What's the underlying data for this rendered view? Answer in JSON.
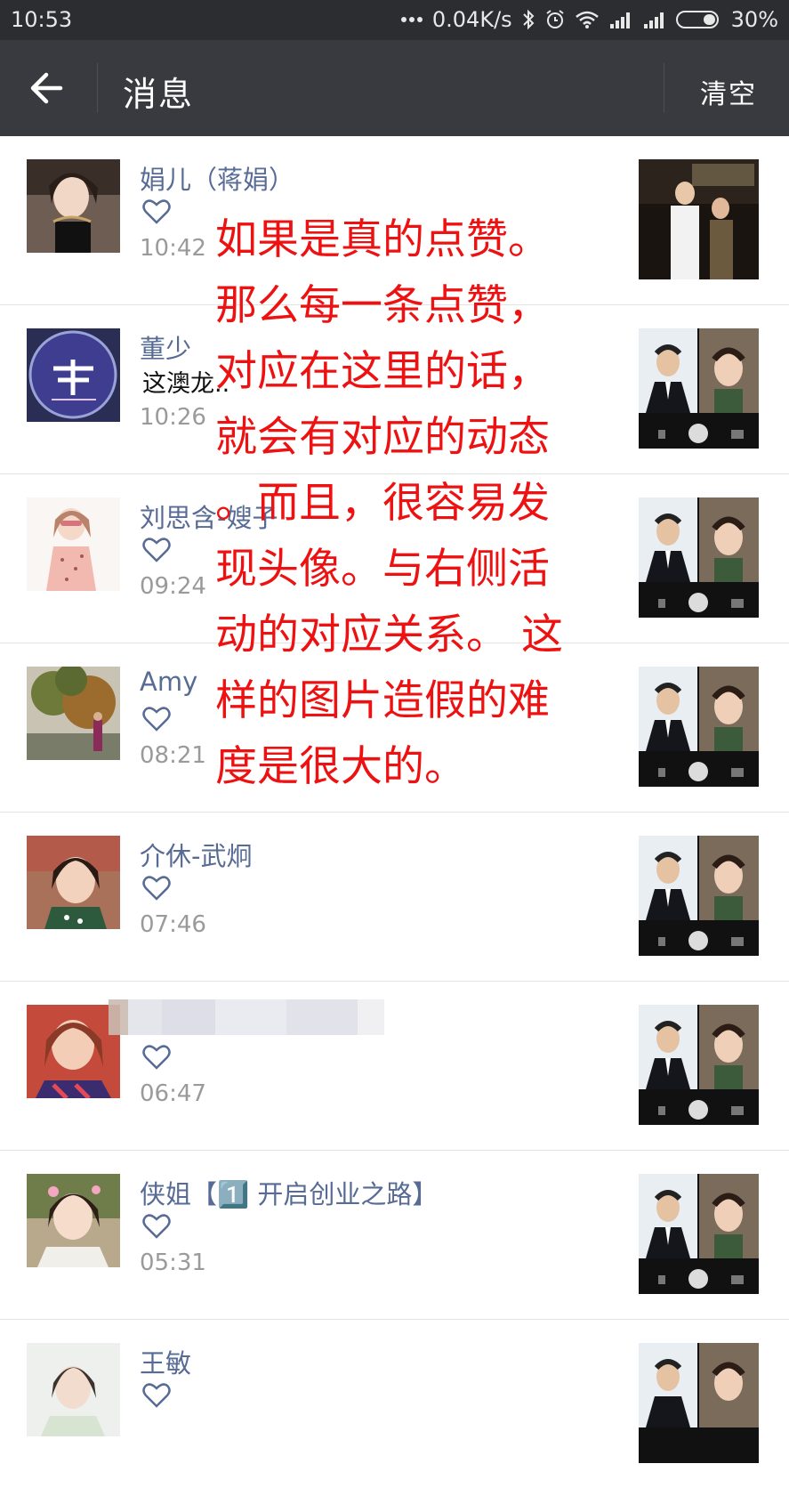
{
  "status_bar": {
    "time": "10:53",
    "network_speed": "0.04K/s",
    "battery": "30%",
    "icons": [
      "more-dots-icon",
      "bluetooth-icon",
      "alarm-icon",
      "wifi-icon",
      "signal-icon",
      "signal-icon",
      "battery-icon"
    ]
  },
  "header": {
    "back_icon": "arrow-left-icon",
    "title": "消息",
    "clear_label": "清空",
    "background": "#393a3f"
  },
  "messages": [
    {
      "name": "娟儿（蒋娟）",
      "type": "like",
      "time": "10:42"
    },
    {
      "name": "董少",
      "type": "comment",
      "text": "这澳龙..",
      "time": "10:26"
    },
    {
      "name": "刘思含-嫂子",
      "type": "like",
      "time": "09:24"
    },
    {
      "name": "Amy",
      "type": "like",
      "time": "08:21"
    },
    {
      "name": "介休-武炯",
      "type": "like",
      "time": "07:46"
    },
    {
      "name": "",
      "type": "like",
      "time": "06:47"
    },
    {
      "name": "侠姐【1️⃣ 开启创业之路】",
      "type": "like",
      "time": "05:31"
    },
    {
      "name": "王敏",
      "type": "like",
      "time": ""
    }
  ],
  "overlay_annotation": {
    "lines": [
      "如果是真的点赞。",
      "那么每一条点赞，",
      "对应在这里的话，",
      "就会有对应的动态",
      "。而且，很容易发",
      "现头像。与右侧活",
      "动的对应关系。 这",
      "样的图片造假的难",
      "度是很大的。"
    ],
    "color": "#ee1111"
  },
  "colors": {
    "name_link": "#576b95",
    "timestamp": "#9a9a9a"
  }
}
